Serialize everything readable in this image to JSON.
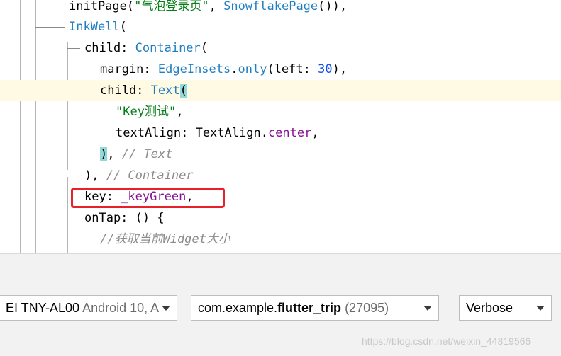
{
  "editor": {
    "current_line": 4,
    "lines": [
      {
        "tokens": [
          {
            "t": "initPage(",
            "c": "plain"
          },
          {
            "t": "\"气泡登录页\"",
            "c": "string"
          },
          {
            "t": ", ",
            "c": "plain"
          },
          {
            "t": "SnowflakePage",
            "c": "class"
          },
          {
            "t": "()),",
            "c": "plain"
          }
        ]
      },
      {
        "tokens": [
          {
            "t": "InkWell",
            "c": "class"
          },
          {
            "t": "(",
            "c": "plain"
          }
        ]
      },
      {
        "tokens": [
          {
            "t": "child: ",
            "c": "plain"
          },
          {
            "t": "Container",
            "c": "class"
          },
          {
            "t": "(",
            "c": "plain"
          }
        ]
      },
      {
        "tokens": [
          {
            "t": "margin: ",
            "c": "plain"
          },
          {
            "t": "EdgeInsets",
            "c": "class"
          },
          {
            "t": ".",
            "c": "plain"
          },
          {
            "t": "only",
            "c": "prop"
          },
          {
            "t": "(left: ",
            "c": "plain"
          },
          {
            "t": "30",
            "c": "num"
          },
          {
            "t": "),",
            "c": "plain"
          }
        ]
      },
      {
        "tokens": [
          {
            "t": "child: ",
            "c": "plain"
          },
          {
            "t": "Text",
            "c": "class"
          },
          {
            "t": "(",
            "c": "brace"
          }
        ]
      },
      {
        "tokens": [
          {
            "t": "\"Key测试\"",
            "c": "string"
          },
          {
            "t": ",",
            "c": "plain"
          }
        ]
      },
      {
        "tokens": [
          {
            "t": "textAlign: TextAlign.",
            "c": "plain"
          },
          {
            "t": "center",
            "c": "field"
          },
          {
            "t": ",",
            "c": "plain"
          }
        ]
      },
      {
        "tokens": [
          {
            "t": ")",
            "c": "brace"
          },
          {
            "t": ", ",
            "c": "plain"
          },
          {
            "t": "// Text",
            "c": "comment"
          }
        ]
      },
      {
        "tokens": [
          {
            "t": "), ",
            "c": "plain"
          },
          {
            "t": "// Container",
            "c": "comment"
          }
        ]
      },
      {
        "tokens": [
          {
            "t": "key: ",
            "c": "plain"
          },
          {
            "t": "_keyGreen",
            "c": "field"
          },
          {
            "t": ",",
            "c": "plain"
          }
        ]
      },
      {
        "tokens": [
          {
            "t": "onTap: () {",
            "c": "plain"
          }
        ]
      },
      {
        "tokens": [
          {
            "t": "//获取当前Widget大小",
            "c": "comment"
          }
        ]
      }
    ]
  },
  "toolbar": {
    "device": {
      "name": "EI TNY-AL00",
      "detail": "Android 10, A"
    },
    "process": {
      "package_prefix": "com.example.",
      "package_name": "flutter_trip",
      "pid": "(27095)"
    },
    "log_level": "Verbose"
  },
  "watermark": "https://blog.csdn.net/weixin_44819566",
  "colors": {
    "highlight_box": "#e8202a",
    "current_line": "#fffae3",
    "brace_match": "#93d9d9"
  }
}
